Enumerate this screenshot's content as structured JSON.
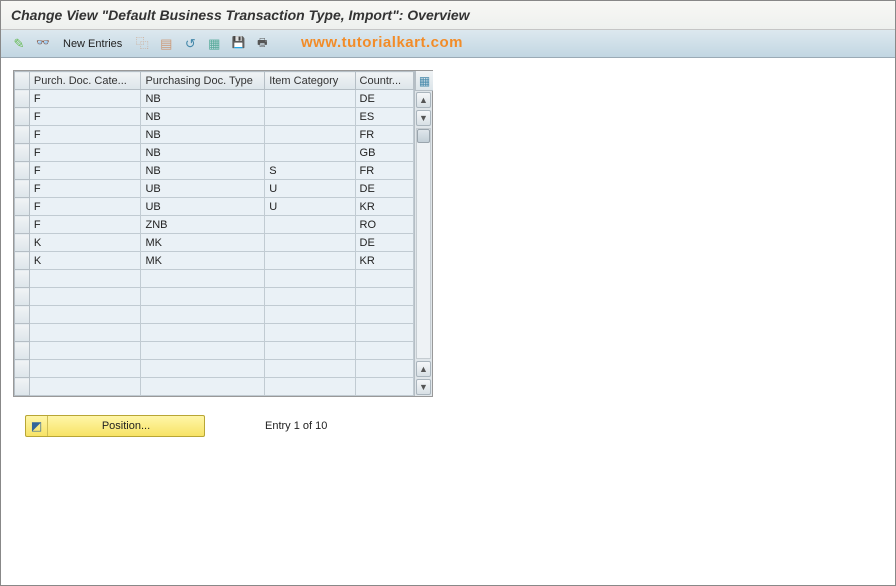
{
  "title": "Change View \"Default Business Transaction Type, Import\": Overview",
  "watermark": "www.tutorialkart.com",
  "toolbar": {
    "new_entries": "New Entries"
  },
  "columns": {
    "c0": "Purch. Doc. Cate...",
    "c1": "Purchasing Doc. Type",
    "c2": "Item Category",
    "c3": "Countr..."
  },
  "rows": [
    {
      "c0": "F",
      "c1": "NB",
      "c2": "",
      "c3": "DE"
    },
    {
      "c0": "F",
      "c1": "NB",
      "c2": "",
      "c3": "ES"
    },
    {
      "c0": "F",
      "c1": "NB",
      "c2": "",
      "c3": "FR"
    },
    {
      "c0": "F",
      "c1": "NB",
      "c2": "",
      "c3": "GB"
    },
    {
      "c0": "F",
      "c1": "NB",
      "c2": "S",
      "c3": "FR"
    },
    {
      "c0": "F",
      "c1": "UB",
      "c2": "U",
      "c3": "DE"
    },
    {
      "c0": "F",
      "c1": "UB",
      "c2": "U",
      "c3": "KR"
    },
    {
      "c0": "F",
      "c1": "ZNB",
      "c2": "",
      "c3": "RO"
    },
    {
      "c0": "K",
      "c1": "MK",
      "c2": "",
      "c3": "DE"
    },
    {
      "c0": "K",
      "c1": "MK",
      "c2": "",
      "c3": "KR"
    }
  ],
  "footer": {
    "position_label": "Position...",
    "entry_text": "Entry 1 of 10"
  }
}
